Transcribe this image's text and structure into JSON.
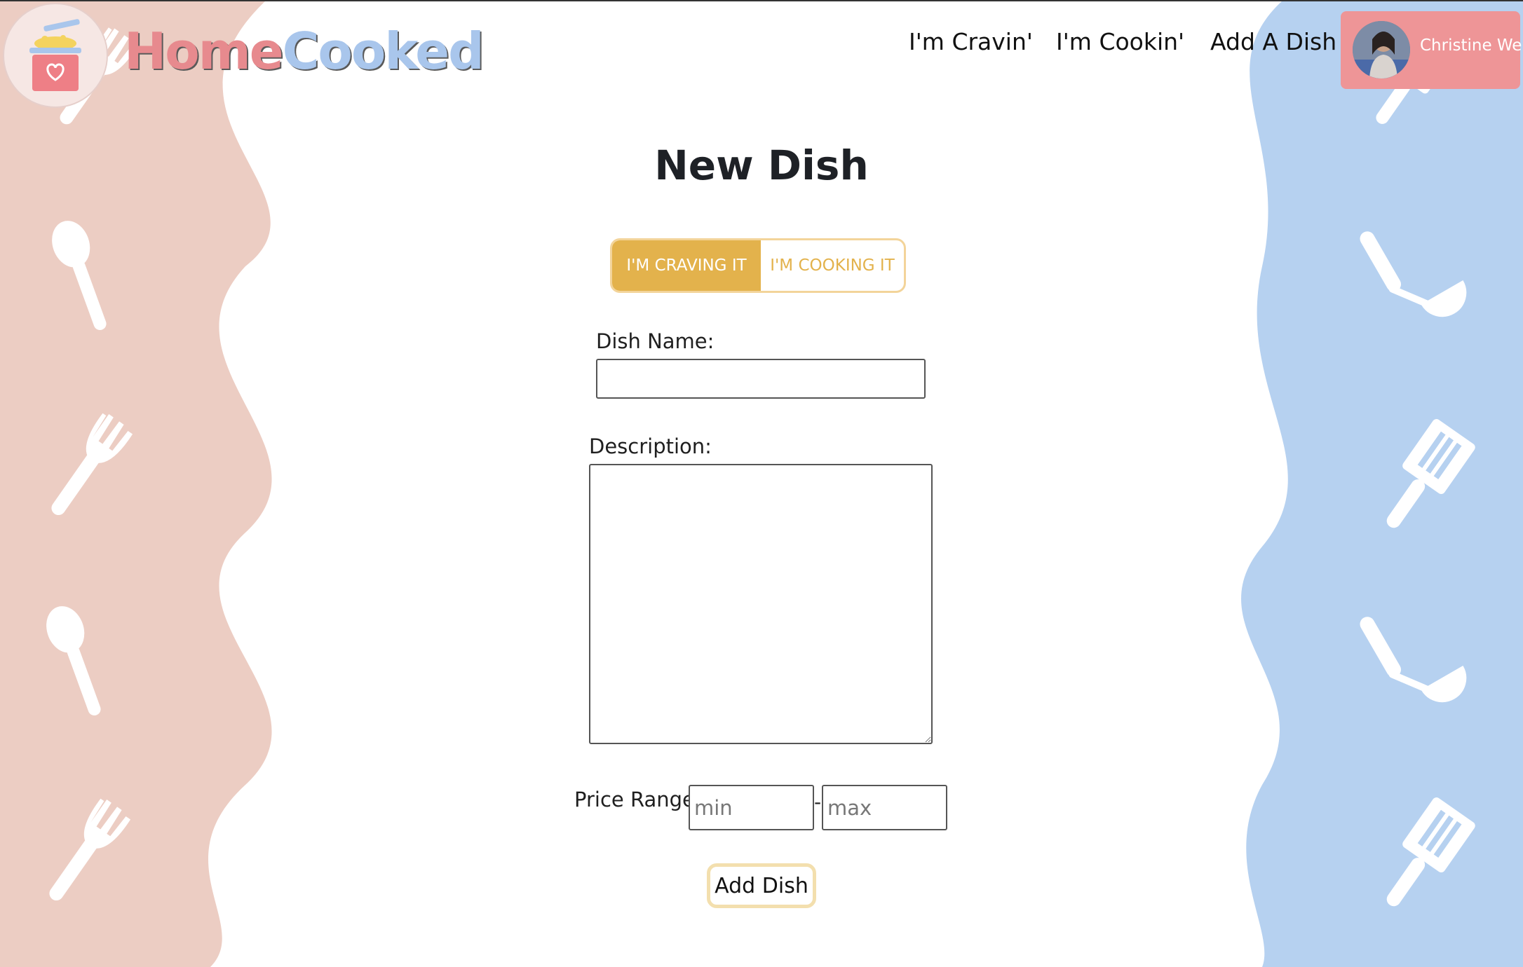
{
  "brand": {
    "part1": "Home",
    "part2": "Cooked"
  },
  "nav": {
    "craving": "I'm Cravin'",
    "cooking": "I'm Cookin'",
    "add": "Add A Dish"
  },
  "user": {
    "name": "Christine Wei"
  },
  "page": {
    "title": "New Dish"
  },
  "toggle": {
    "option_craving": "I'M CRAVING IT",
    "option_cooking": "I'M COOKING IT",
    "selected": "I'M CRAVING IT"
  },
  "form": {
    "dish_name_label": "Dish Name:",
    "dish_name_value": "",
    "description_label": "Description:",
    "description_value": "",
    "price_label": "Price Range:",
    "price_min_placeholder": "min",
    "price_max_placeholder": "max",
    "price_separator": "-",
    "submit_label": "Add Dish"
  },
  "colors": {
    "left_wave": "#eccdc3",
    "right_wave": "#b6d1f0",
    "brand_home": "#e78a8e",
    "brand_cooked": "#a9c6ec",
    "accent_gold": "#e3b24c",
    "user_chip": "#ee9597"
  },
  "icons": {
    "left_column": [
      "fork-icon",
      "spoon-icon",
      "fork-icon",
      "spoon-icon",
      "fork-icon"
    ],
    "right_column": [
      "spatula-icon",
      "ladle-icon",
      "spatula-icon",
      "ladle-icon",
      "spatula-icon"
    ]
  }
}
